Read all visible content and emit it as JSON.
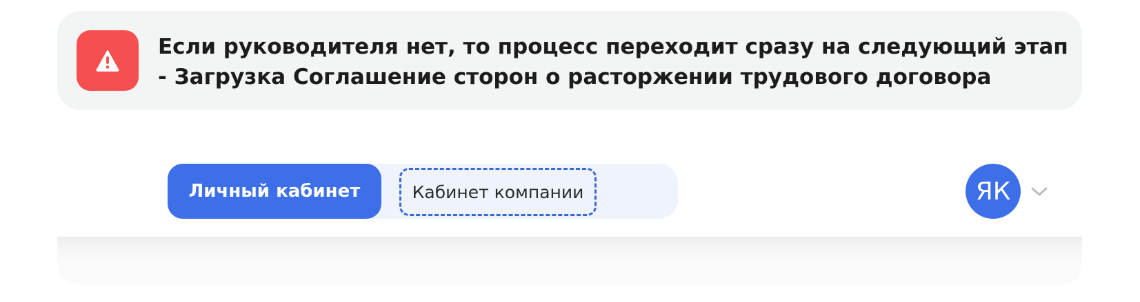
{
  "notice": {
    "icon": "warning-icon",
    "accent_color": "#f5504f",
    "line1": "Если руководителя нет, то процесс переходит сразу на следующий этап",
    "line2": "- Загрузка Соглашение сторон о расторжении трудового договора"
  },
  "header": {
    "tabs": {
      "personal_label": "Личный кабинет",
      "company_label": "Кабинет компании",
      "active_color": "#3d6fe8"
    },
    "user": {
      "initials": "ЯК",
      "menu_icon": "chevron-down-icon"
    }
  }
}
